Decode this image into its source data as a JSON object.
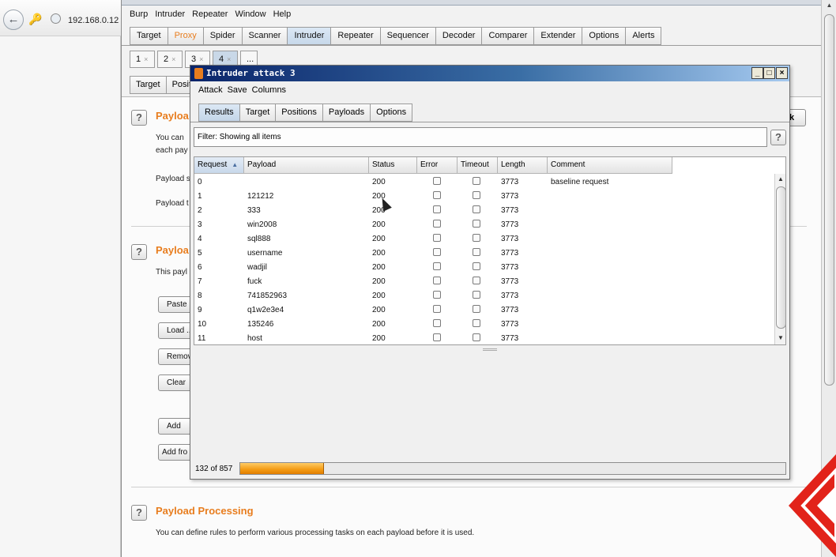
{
  "browser": {
    "url": "192.168.0.12"
  },
  "burp": {
    "menu": [
      "Burp",
      "Intruder",
      "Repeater",
      "Window",
      "Help"
    ],
    "main_tabs": [
      "Target",
      "Proxy",
      "Spider",
      "Scanner",
      "Intruder",
      "Repeater",
      "Sequencer",
      "Decoder",
      "Comparer",
      "Extender",
      "Options",
      "Alerts"
    ],
    "attack_tabs": [
      "1",
      "2",
      "3",
      "4",
      "..."
    ],
    "sub_tabs": [
      "Target",
      "Positio"
    ],
    "sections": {
      "payload_sets": {
        "title": "Payloa",
        "text1": "You can",
        "text2": "each pay",
        "label1": "Payload s",
        "label2": "Payload t"
      },
      "payload_options": {
        "title": "Payloa",
        "text": "This payl",
        "buttons": [
          "Paste",
          "Load ...",
          "Remove",
          "Clear",
          "Add",
          "Add fro"
        ]
      },
      "payload_processing": {
        "title": "Payload Processing",
        "text": "You can define rules to perform various processing tasks on each payload before it is used."
      }
    },
    "right_partial_button": "k"
  },
  "dialog": {
    "title": "Intruder attack 3",
    "menu": [
      "Attack",
      "Save",
      "Columns"
    ],
    "tabs": [
      "Results",
      "Target",
      "Positions",
      "Payloads",
      "Options"
    ],
    "filter_text": "Filter: Showing all items",
    "columns": [
      "Request",
      "Payload",
      "Status",
      "Error",
      "Timeout",
      "Length",
      "Comment"
    ],
    "rows": [
      {
        "request": "0",
        "payload": "",
        "status": "200",
        "length": "3773",
        "comment": "baseline request"
      },
      {
        "request": "1",
        "payload": "121212",
        "status": "200",
        "length": "3773",
        "comment": ""
      },
      {
        "request": "2",
        "payload": "333",
        "status": "200",
        "length": "3773",
        "comment": ""
      },
      {
        "request": "3",
        "payload": "win2008",
        "status": "200",
        "length": "3773",
        "comment": ""
      },
      {
        "request": "4",
        "payload": "sql888",
        "status": "200",
        "length": "3773",
        "comment": ""
      },
      {
        "request": "5",
        "payload": "username",
        "status": "200",
        "length": "3773",
        "comment": ""
      },
      {
        "request": "6",
        "payload": "wadjil",
        "status": "200",
        "length": "3773",
        "comment": ""
      },
      {
        "request": "7",
        "payload": "fuck",
        "status": "200",
        "length": "3773",
        "comment": ""
      },
      {
        "request": "8",
        "payload": "741852963",
        "status": "200",
        "length": "3773",
        "comment": ""
      },
      {
        "request": "9",
        "payload": "q1w2e3e4",
        "status": "200",
        "length": "3773",
        "comment": ""
      },
      {
        "request": "10",
        "payload": "135246",
        "status": "200",
        "length": "3773",
        "comment": ""
      },
      {
        "request": "11",
        "payload": "host",
        "status": "200",
        "length": "3773",
        "comment": ""
      }
    ],
    "progress": {
      "label": "132 of 857",
      "done": 132,
      "total": 857
    }
  },
  "colors": {
    "accent_orange": "#e87d1e",
    "progress_orange": "#f39a12",
    "title_bar_blue": "#0a246a"
  }
}
